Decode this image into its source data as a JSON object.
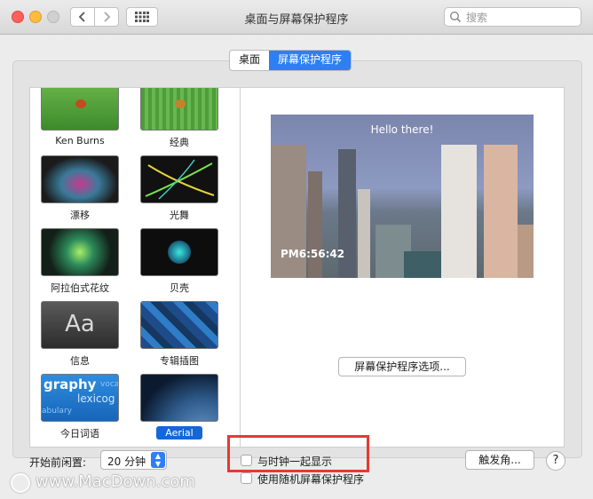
{
  "window": {
    "title": "桌面与屏幕保护程序"
  },
  "search": {
    "placeholder": "搜索"
  },
  "tabs": [
    {
      "label": "桌面",
      "active": false
    },
    {
      "label": "屏幕保护程序",
      "active": true
    }
  ],
  "savers": [
    {
      "label": "Ken Burns",
      "selected": false
    },
    {
      "label": "经典",
      "selected": false
    },
    {
      "label": "漂移",
      "selected": false
    },
    {
      "label": "光舞",
      "selected": false
    },
    {
      "label": "阿拉伯式花纹",
      "selected": false
    },
    {
      "label": "贝壳",
      "selected": false
    },
    {
      "label": "信息",
      "selected": false,
      "thumb_text": "Aa"
    },
    {
      "label": "专辑插图",
      "selected": false
    },
    {
      "label": "今日词语",
      "selected": false,
      "thumb_text": "graphy",
      "thumb_text2": "lexicog",
      "thumb_text3": "voca",
      "thumb_text4": "abulary"
    },
    {
      "label": "Aerial",
      "selected": true
    }
  ],
  "preview": {
    "greeting": "Hello there!",
    "clock": "PM6:56:42"
  },
  "options_button": "屏幕保护程序选项...",
  "idle": {
    "label": "开始前闲置:",
    "value": "20 分钟"
  },
  "show_with_clock": {
    "label": "与时钟一起显示",
    "checked": false
  },
  "use_random": {
    "label": "使用随机屏幕保护程序",
    "checked": false
  },
  "hot_corners_button": "触发角...",
  "help_button": "?",
  "watermark": "www.MacDown.com",
  "colors": {
    "accent": "#2d7ff5",
    "highlight": "#e63a2e"
  }
}
